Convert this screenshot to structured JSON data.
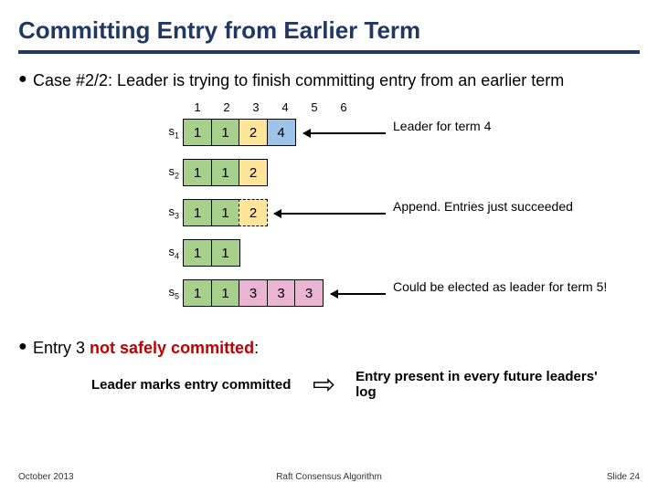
{
  "title": "Committing Entry from Earlier Term",
  "bullet1": "Case #2/2: Leader is trying to finish committing entry from an earlier term",
  "indices": [
    "1",
    "2",
    "3",
    "4",
    "5",
    "6"
  ],
  "servers": {
    "s1": {
      "label_main": "s",
      "label_sub": "1",
      "cells": [
        {
          "v": "1",
          "cls": "term1"
        },
        {
          "v": "1",
          "cls": "term1"
        },
        {
          "v": "2",
          "cls": "term2"
        },
        {
          "v": "4",
          "cls": "term4"
        }
      ]
    },
    "s2": {
      "label_main": "s",
      "label_sub": "2",
      "cells": [
        {
          "v": "1",
          "cls": "term1"
        },
        {
          "v": "1",
          "cls": "term1"
        },
        {
          "v": "2",
          "cls": "term2"
        }
      ]
    },
    "s3": {
      "label_main": "s",
      "label_sub": "3",
      "cells": [
        {
          "v": "1",
          "cls": "term1"
        },
        {
          "v": "1",
          "cls": "term1"
        },
        {
          "v": "2",
          "cls": "term2",
          "dashed": true
        }
      ]
    },
    "s4": {
      "label_main": "s",
      "label_sub": "4",
      "cells": [
        {
          "v": "1",
          "cls": "term1"
        },
        {
          "v": "1",
          "cls": "term1"
        }
      ]
    },
    "s5": {
      "label_main": "s",
      "label_sub": "5",
      "cells": [
        {
          "v": "1",
          "cls": "term1"
        },
        {
          "v": "1",
          "cls": "term1"
        },
        {
          "v": "3",
          "cls": "term3"
        },
        {
          "v": "3",
          "cls": "term3"
        },
        {
          "v": "3",
          "cls": "term3"
        }
      ]
    }
  },
  "annot_leader": "Leader for term 4",
  "annot_append": "Append. Entries just succeeded",
  "annot_elected": "Could be elected as leader for term 5!",
  "bullet2_pre": "Entry 3 ",
  "bullet2_unsafe": "not safely committed",
  "bullet2_post": ":",
  "bottom_left": "Leader marks entry committed",
  "big_arrow": "⇨",
  "bottom_right": "Entry present in every future leaders' log",
  "footer_left": "October 2013",
  "footer_center": "Raft Consensus Algorithm",
  "footer_right": "Slide 24"
}
